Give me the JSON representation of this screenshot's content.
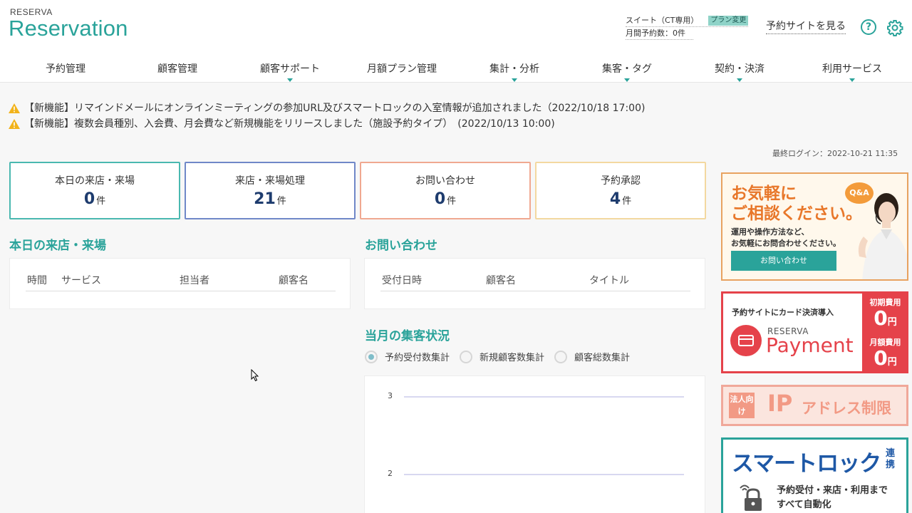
{
  "header": {
    "logo_small": "RESERVA",
    "logo_main": "Reservation",
    "plan_name": "スイート（CT専用）",
    "plan_change": "プラン変更",
    "monthly_reservations": "月間予約数：0件",
    "site_link": "予約サイトを見る",
    "help_label": "?"
  },
  "nav": [
    {
      "label": "予約管理",
      "has_caret": false
    },
    {
      "label": "顧客管理",
      "has_caret": false
    },
    {
      "label": "顧客サポート",
      "has_caret": true
    },
    {
      "label": "月額プラン管理",
      "has_caret": false
    },
    {
      "label": "集計・分析",
      "has_caret": true
    },
    {
      "label": "集客・タグ",
      "has_caret": true
    },
    {
      "label": "契約・決済",
      "has_caret": true
    },
    {
      "label": "利用サービス",
      "has_caret": true
    }
  ],
  "notices": [
    "【新機能】リマインドメールにオンラインミーティングの参加URL及びスマートロックの入室情報が追加されました（2022/10/18 17:00)",
    "【新機能】複数会員種別、入会費、月会費など新規機能をリリースしました（施設予約タイプ）　(2022/10/13 10:00)"
  ],
  "last_login": "最終ログイン：2022-10-21 11:35",
  "stats": [
    {
      "label": "本日の来店・来場",
      "value": "0",
      "unit": "件",
      "color": "#4ab8b0"
    },
    {
      "label": "来店・来場処理",
      "value": "21",
      "unit": "件",
      "color": "#7088c8"
    },
    {
      "label": "お問い合わせ",
      "value": "0",
      "unit": "件",
      "color": "#f0a890"
    },
    {
      "label": "予約承認",
      "value": "4",
      "unit": "件",
      "color": "#f3d8a0"
    }
  ],
  "today_section": {
    "title": "本日の来店・来場",
    "columns": [
      "時間",
      "サービス",
      "担当者",
      "顧客名"
    ]
  },
  "inquiry_section": {
    "title": "お問い合わせ",
    "columns": [
      "受付日時",
      "顧客名",
      "タイトル"
    ]
  },
  "monthly_section": {
    "title": "当月の集客状況",
    "options": [
      {
        "label": "予約受付数集計",
        "checked": true
      },
      {
        "label": "新規顧客数集計",
        "checked": false
      },
      {
        "label": "顧客総数集計",
        "checked": false
      }
    ]
  },
  "chart_data": {
    "type": "line",
    "yticks": [
      3,
      2
    ],
    "series": []
  },
  "ads": {
    "consult": {
      "title_line1": "お気軽に",
      "title_line2": "ご相談ください。",
      "sub_line1": "運用や操作方法など、",
      "sub_line2": "お気軽にお問合わせください。",
      "button": "お問い合わせ",
      "qa": "Q&A"
    },
    "payment": {
      "head": "予約サイトにカード決済導入",
      "brand": "RESERVA",
      "name": "Payment",
      "initial_label": "初期費用",
      "initial_value": "0",
      "monthly_label": "月額費用",
      "monthly_value": "0",
      "yen": "円"
    },
    "ip": {
      "badge": "法人向け",
      "ip": "IP",
      "text": "アドレス制限"
    },
    "smartlock": {
      "title": "スマートロック",
      "side": "連携",
      "line1": "予約受付・来店・利用まで",
      "line2": "すべて自動化"
    }
  }
}
